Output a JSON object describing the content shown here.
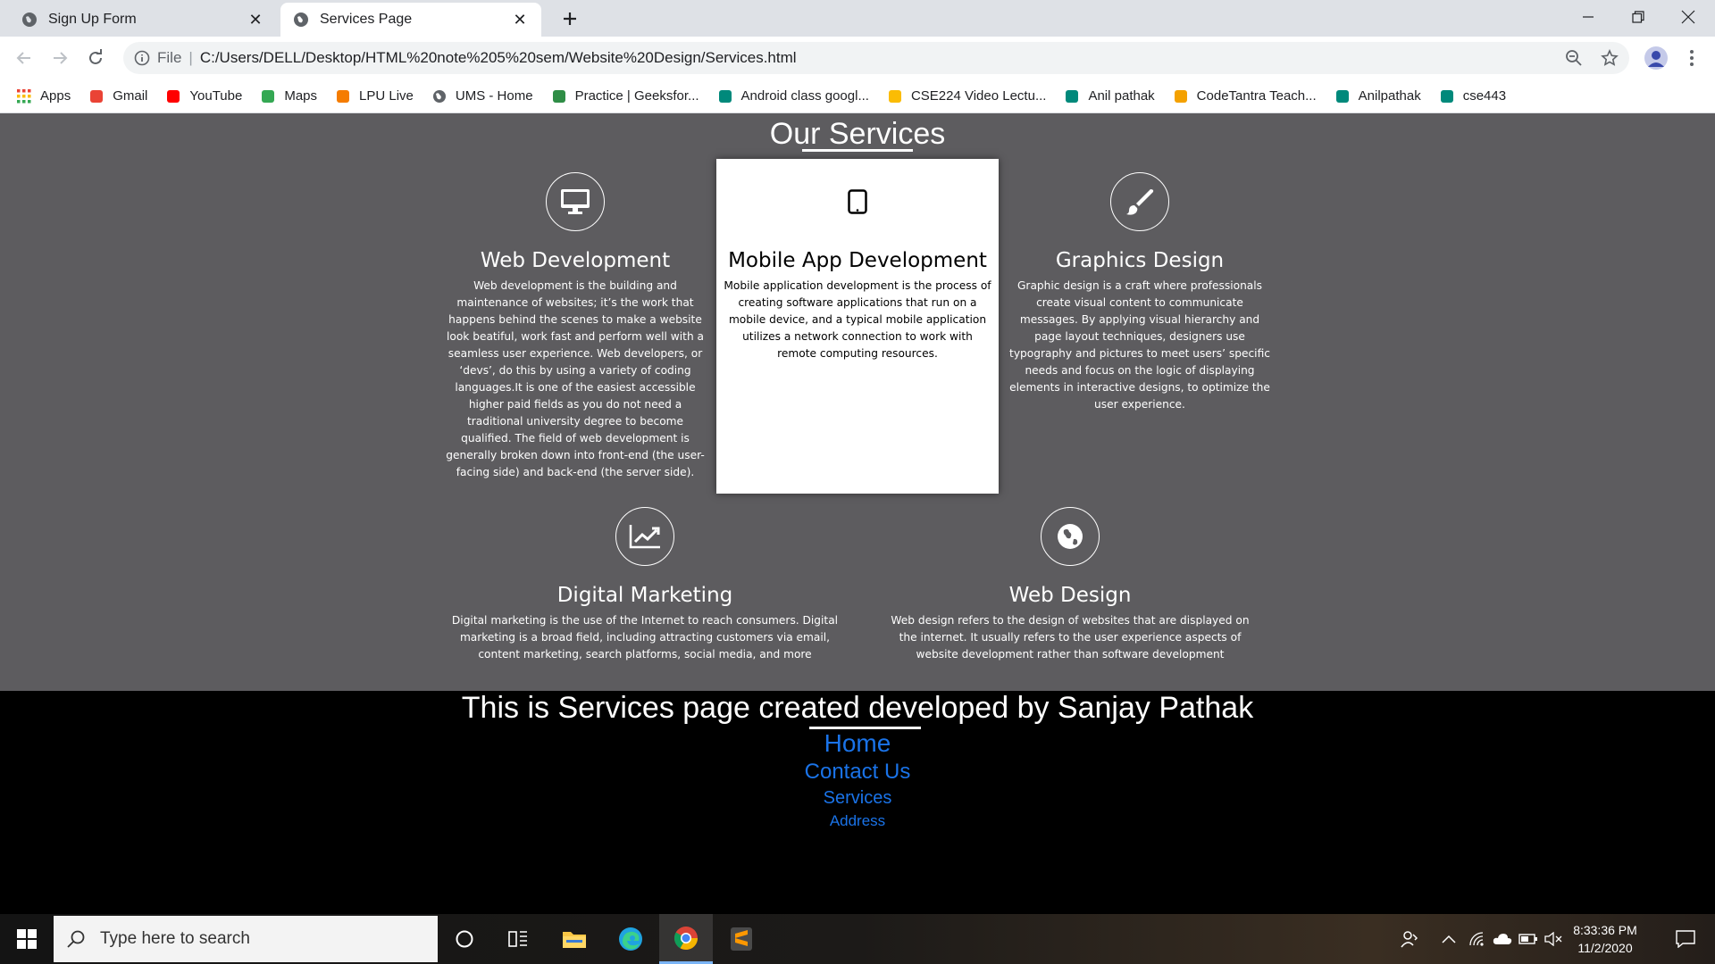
{
  "browser": {
    "tabs": [
      {
        "title": "Sign Up Form",
        "active": false
      },
      {
        "title": "Services Page",
        "active": true
      }
    ],
    "address": {
      "scheme_label": "File",
      "url": "C:/Users/DELL/Desktop/HTML%20note%205%20sem/Website%20Design/Services.html"
    },
    "bookmarks": [
      {
        "label": "Apps",
        "icon": "apps-grid-icon",
        "color": "#4285f4"
      },
      {
        "label": "Gmail",
        "icon": "gmail-icon",
        "color": "#ea4335"
      },
      {
        "label": "YouTube",
        "icon": "youtube-icon",
        "color": "#ff0000"
      },
      {
        "label": "Maps",
        "icon": "maps-icon",
        "color": "#34a853"
      },
      {
        "label": "LPU Live",
        "icon": "lpu-live-icon",
        "color": "#f57c00"
      },
      {
        "label": "UMS - Home",
        "icon": "globe-icon",
        "color": "#5f6368"
      },
      {
        "label": "Practice | Geeksfor...",
        "icon": "geeksforgeeks-icon",
        "color": "#2f8d46"
      },
      {
        "label": "Android class googl...",
        "icon": "google-meet-icon",
        "color": "#00897b"
      },
      {
        "label": "CSE224 Video Lectu...",
        "icon": "google-drive-icon",
        "color": "#fbbc04"
      },
      {
        "label": "Anil pathak",
        "icon": "google-meet-icon",
        "color": "#00897b"
      },
      {
        "label": "CodeTantra Teach...",
        "icon": "codetantra-icon",
        "color": "#f4a100"
      },
      {
        "label": "Anilpathak",
        "icon": "google-meet-icon",
        "color": "#00897b"
      },
      {
        "label": "cse443",
        "icon": "google-meet-icon",
        "color": "#00897b"
      }
    ]
  },
  "page": {
    "heading": "Our Services",
    "services": [
      {
        "id": "web-development",
        "icon": "monitor-icon",
        "title": "Web Development",
        "description": "Web development is the building and maintenance of websites; it’s the work that happens behind the scenes to make a website look beatiful, work fast and perform well with a seamless user experience. Web developers, or ‘devs’, do this by using a variety of coding languages.It is one of the easiest accessible higher paid fields as you do not need a traditional university degree to become qualified. The field of web development is generally broken down into front-end (the user-facing side) and back-end (the server side)."
      },
      {
        "id": "mobile-app-development",
        "icon": "tablet-icon",
        "title": "Mobile App Development",
        "description": "Mobile application development is the process of creating software applications that run on a mobile device, and a typical mobile application utilizes a network connection to work with remote computing resources."
      },
      {
        "id": "graphics-design",
        "icon": "paint-brush-icon",
        "title": "Graphics Design",
        "description": "Graphic design is a craft where professionals create visual content to communicate messages. By applying visual hierarchy and page layout techniques, designers use typography and pictures to meet users’ specific needs and focus on the logic of displaying elements in interactive designs, to optimize the user experience."
      },
      {
        "id": "digital-marketing",
        "icon": "line-chart-icon",
        "title": "Digital Marketing",
        "description": "Digital marketing is the use of the Internet to reach consumers. Digital marketing is a broad field, including attracting customers via email, content marketing, search platforms, social media, and more"
      },
      {
        "id": "web-design",
        "icon": "globe-icon",
        "title": "Web Design",
        "description": "Web design refers to the design of websites that are displayed on the internet. It usually refers to the user experience aspects of website development rather than software development"
      }
    ],
    "footer": {
      "title": "This is Services page created developed by Sanjay Pathak",
      "links": [
        "Home",
        "Contact Us",
        "Services",
        "Address"
      ],
      "link_color": "#1a73e8"
    },
    "colors": {
      "services_bg": "#5d5c5f",
      "footer_bg": "#000000"
    }
  },
  "taskbar": {
    "search_placeholder": "Type here to search",
    "clock_time": "8:33:36 PM",
    "clock_date": "11/2/2020"
  }
}
